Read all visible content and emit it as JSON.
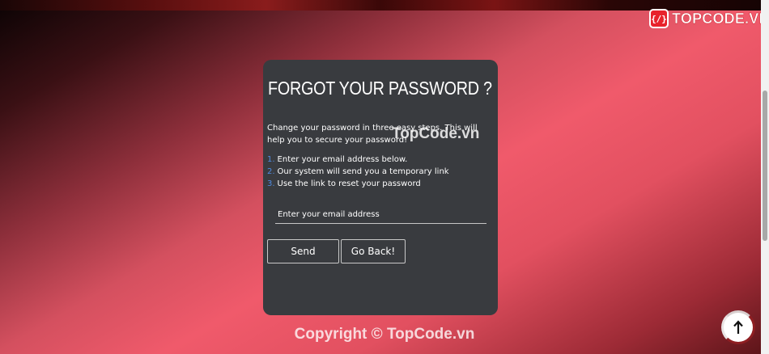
{
  "brand": {
    "badge": "{/}",
    "name": "TOPCODE.VN"
  },
  "card": {
    "title": "FORGOT YOUR PASSWORD ?",
    "description": "Change your password in three easy steps. This will help you to secure your password!",
    "steps": [
      {
        "num": "1.",
        "text": "Enter your email address below."
      },
      {
        "num": "2.",
        "text": "Our system will send you a temporary link"
      },
      {
        "num": "3.",
        "text": "Use the link to reset your password"
      }
    ],
    "email_placeholder": "Enter your email address",
    "email_value": "",
    "send_label": "Send",
    "back_label": "Go Back!"
  },
  "watermark": "TopCode.vn",
  "footer": {
    "copyright": "Copyright © TopCode.vn"
  },
  "icons": {
    "scroll_top": "arrow-up-icon"
  }
}
